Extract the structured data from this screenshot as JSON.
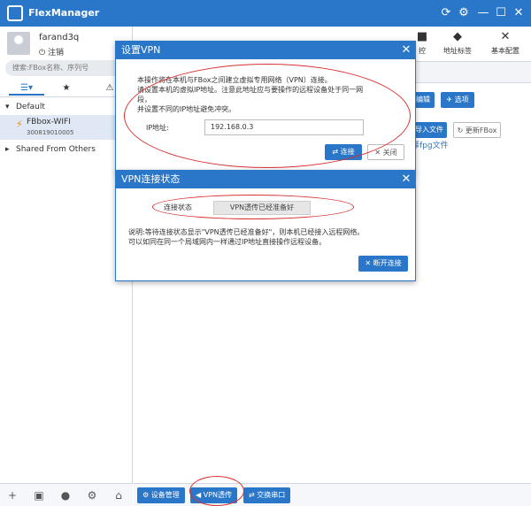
{
  "app": {
    "title": "FlexManager"
  },
  "user": {
    "name": "farand3q",
    "logout_label": "注销"
  },
  "search": {
    "placeholder": "搜索:FBox名称、序列号"
  },
  "tree": {
    "default_group": "Default",
    "default_count": "(",
    "device_name": "FBbox-WIFI",
    "device_sn": "300819010005",
    "shared_group": "Shared From Others",
    "shared_count": "("
  },
  "toolbar": {
    "items": [
      "地址标签",
      "基本配置"
    ],
    "partial_item": "控"
  },
  "content": {
    "edit_btn": "编辑",
    "select_btn": "✈ 选项",
    "import_btn": "导入文件",
    "update_btn": "更新FBox",
    "link_text": "择fpg文件"
  },
  "bottom_bar": {
    "device_mgmt": "设备管理",
    "vpn": "VPN透传",
    "serial": "交换串口"
  },
  "dialog_vpn": {
    "title": "设置VPN",
    "desc_lines": [
      "本操作将在本机与FBox之间建立虚拟专用网络（VPN）连接。",
      "请设置本机的虚拟IP地址。注意此地址应与要操作的远程设备处于同一网",
      "段，",
      "并设置不同的IP地址避免冲突。"
    ],
    "ip_label": "IP地址:",
    "ip_value": "192.168.0.3",
    "connect_btn": "连接",
    "close_btn": "关闭"
  },
  "dialog_status": {
    "title": "VPN连接状态",
    "status_label": "连接状态",
    "status_value": "VPN透传已经准备好",
    "desc_lines": [
      "说明:等待连接状态显示\"VPN透传已经准备好\"，则本机已经接入远程网络。",
      "可以如同在同一个局域网内一样通过IP地址直接操作远程设备。"
    ],
    "disconnect_btn": "断开连接"
  }
}
